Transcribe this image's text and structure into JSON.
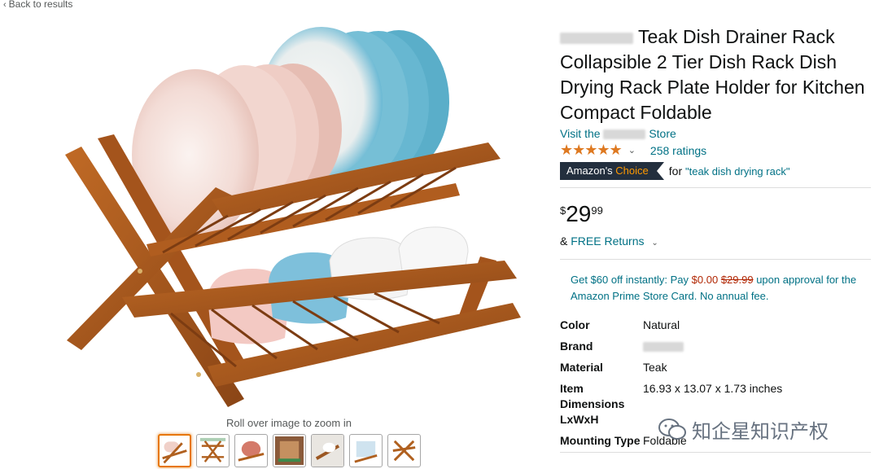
{
  "nav": {
    "back_label": "Back to results"
  },
  "gallery": {
    "zoom_hint": "Roll over image to zoom in",
    "thumbnail_count": 7,
    "active_index": 0
  },
  "product": {
    "title_after_brand": "Teak Dish Drainer Rack Collapsible 2 Tier Dish Rack Dish Drying Rack Plate Holder for Kitchen Compact Foldable",
    "store_prefix": "Visit the",
    "store_suffix": "Store",
    "rating": 4.5,
    "stars_glyph": "★★★★★",
    "ratings_count": "258 ratings",
    "badge": {
      "part1": "Amazon's",
      "part2": "Choice",
      "for_text": "for",
      "query": "\"teak dish drying rack\""
    },
    "price": {
      "symbol": "$",
      "whole": "29",
      "fraction": "99"
    },
    "returns": {
      "prefix": "&",
      "link": "FREE Returns"
    },
    "promo": {
      "text1": "Get $60 off instantly: Pay",
      "pay_price": "$0.00",
      "old_price": "$29.99",
      "text2": "upon approval for the Amazon Prime Store Card. No annual fee."
    },
    "specs": [
      {
        "key": "Color",
        "value": "Natural"
      },
      {
        "key": "Brand",
        "value": ""
      },
      {
        "key": "Material",
        "value": "Teak"
      },
      {
        "key": "Item Dimensions LxWxH",
        "value": "16.93 x 13.07 x 1.73 inches"
      },
      {
        "key": "Mounting Type",
        "value": "Foldable"
      }
    ]
  },
  "watermark": {
    "text": "知企星知识产权"
  },
  "colors": {
    "link": "#007185",
    "star": "#de7921",
    "badge_bg": "#232f3e",
    "badge_accent": "#ff9900",
    "price_red": "#b12704",
    "thumb_active": "#e77600"
  }
}
